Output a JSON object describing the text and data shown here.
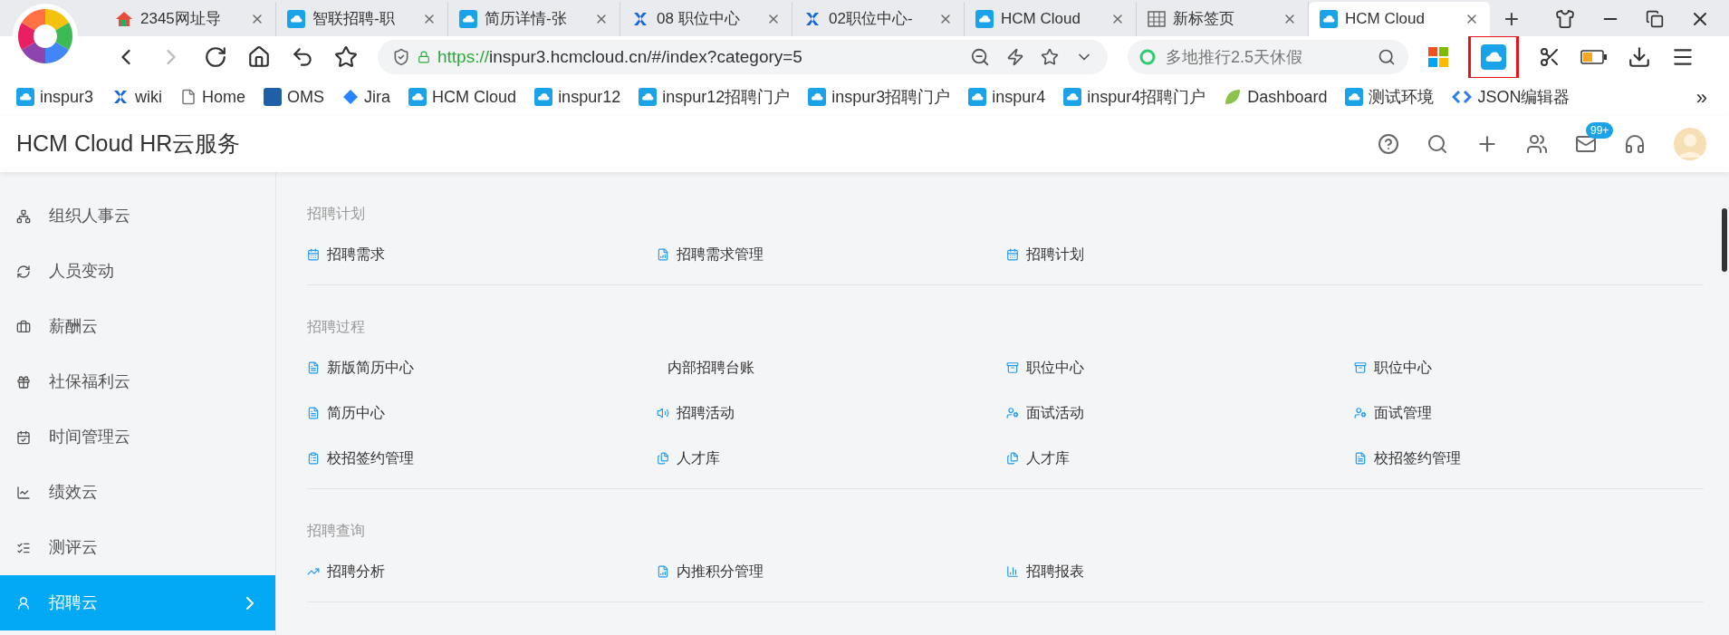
{
  "browser": {
    "tabs": [
      {
        "label": "2345网址导",
        "selected": false
      },
      {
        "label": "智联招聘-职",
        "selected": false
      },
      {
        "label": "简历详情-张",
        "selected": false
      },
      {
        "label": "08 职位中心",
        "selected": false
      },
      {
        "label": "02职位中心-",
        "selected": false
      },
      {
        "label": "HCM Cloud",
        "selected": false
      },
      {
        "label": "新标签页",
        "selected": false
      },
      {
        "label": "HCM Cloud",
        "selected": true
      }
    ],
    "new_tab": "+",
    "address": {
      "scheme": "https://",
      "url": "inspur3.hcmcloud.cn/#/index?category=5"
    },
    "search": {
      "placeholder": "多地推行2.5天休假"
    },
    "bookmarks": [
      {
        "label": "inspur3"
      },
      {
        "label": "wiki"
      },
      {
        "label": "Home"
      },
      {
        "label": "OMS"
      },
      {
        "label": "Jira"
      },
      {
        "label": "HCM Cloud"
      },
      {
        "label": "inspur12"
      },
      {
        "label": "inspur12招聘门户"
      },
      {
        "label": "inspur3招聘门户"
      },
      {
        "label": "inspur4"
      },
      {
        "label": "inspur4招聘门户"
      },
      {
        "label": "Dashboard"
      },
      {
        "label": "测试环境"
      },
      {
        "label": "JSON编辑器"
      }
    ],
    "bookmarks_more": "»"
  },
  "app": {
    "title": "HCM Cloud HR云服务",
    "mail_badge": "99+"
  },
  "sidebar": {
    "items": [
      {
        "label": "组织人事云",
        "selected": false
      },
      {
        "label": "人员变动",
        "selected": false
      },
      {
        "label": "薪酬云",
        "selected": false
      },
      {
        "label": "社保福利云",
        "selected": false
      },
      {
        "label": "时间管理云",
        "selected": false
      },
      {
        "label": "绩效云",
        "selected": false
      },
      {
        "label": "测评云",
        "selected": false
      },
      {
        "label": "招聘云",
        "selected": true
      }
    ]
  },
  "sections": [
    {
      "title": "招聘计划",
      "items": [
        {
          "label": "招聘需求",
          "kind": "icon"
        },
        {
          "label": "招聘需求管理",
          "kind": "icon"
        },
        {
          "label": "招聘计划",
          "kind": "icon"
        }
      ]
    },
    {
      "title": "招聘过程",
      "items": [
        {
          "label": "新版简历中心",
          "kind": "icon"
        },
        {
          "label": "内部招聘台账",
          "kind": "plain"
        },
        {
          "label": "职位中心",
          "kind": "icon"
        },
        {
          "label": "职位中心",
          "kind": "icon"
        },
        {
          "label": "简历中心",
          "kind": "icon"
        },
        {
          "label": "招聘活动",
          "kind": "icon"
        },
        {
          "label": "面试活动",
          "kind": "icon"
        },
        {
          "label": "面试管理",
          "kind": "icon"
        },
        {
          "label": "校招签约管理",
          "kind": "icon"
        },
        {
          "label": "人才库",
          "kind": "icon"
        },
        {
          "label": "人才库",
          "kind": "icon"
        },
        {
          "label": "校招签约管理",
          "kind": "icon"
        }
      ]
    },
    {
      "title": "招聘查询",
      "items": [
        {
          "label": "招聘分析",
          "kind": "icon"
        },
        {
          "label": "内推积分管理",
          "kind": "icon"
        },
        {
          "label": "招聘报表",
          "kind": "icon"
        }
      ]
    }
  ]
}
